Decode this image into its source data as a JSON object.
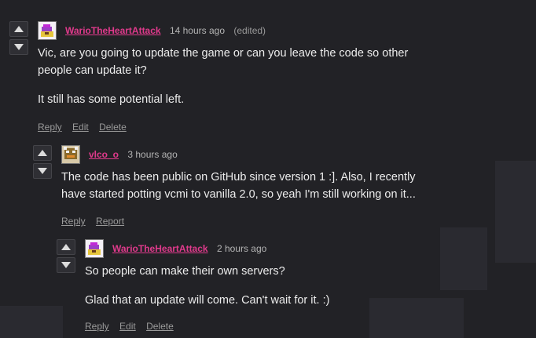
{
  "comments": [
    {
      "username": "WarioTheHeartAttack",
      "time": "14 hours ago",
      "edited": "(edited)",
      "body": [
        "Vic, are you going to update the game or can you leave the code so other",
        "people can update it?",
        "It still has some potential left."
      ],
      "actions": {
        "reply": "Reply",
        "edit": "Edit",
        "delete": "Delete"
      },
      "avatar_icon": "wario-avatar-icon"
    },
    {
      "username": "vlco_o",
      "time": "3 hours ago",
      "body": [
        "The code has been public on GitHub since version 1 :]. Also, I recently",
        "have started potting vcmi to vanilla 2.0, so yeah I'm still working on it..."
      ],
      "actions": {
        "reply": "Reply",
        "report": "Report"
      },
      "avatar_icon": "bowser-avatar-icon"
    },
    {
      "username": "WarioTheHeartAttack",
      "time": "2 hours ago",
      "body": [
        "So people can make their own servers?",
        "Glad that an update will come. Can't wait for it. :)"
      ],
      "actions": {
        "reply": "Reply",
        "edit": "Edit",
        "delete": "Delete"
      },
      "avatar_icon": "wario-avatar-icon"
    }
  ],
  "colors": {
    "background": "#222226",
    "username": "#e03a8c",
    "text": "#ececec",
    "muted": "#9a9a9a"
  }
}
